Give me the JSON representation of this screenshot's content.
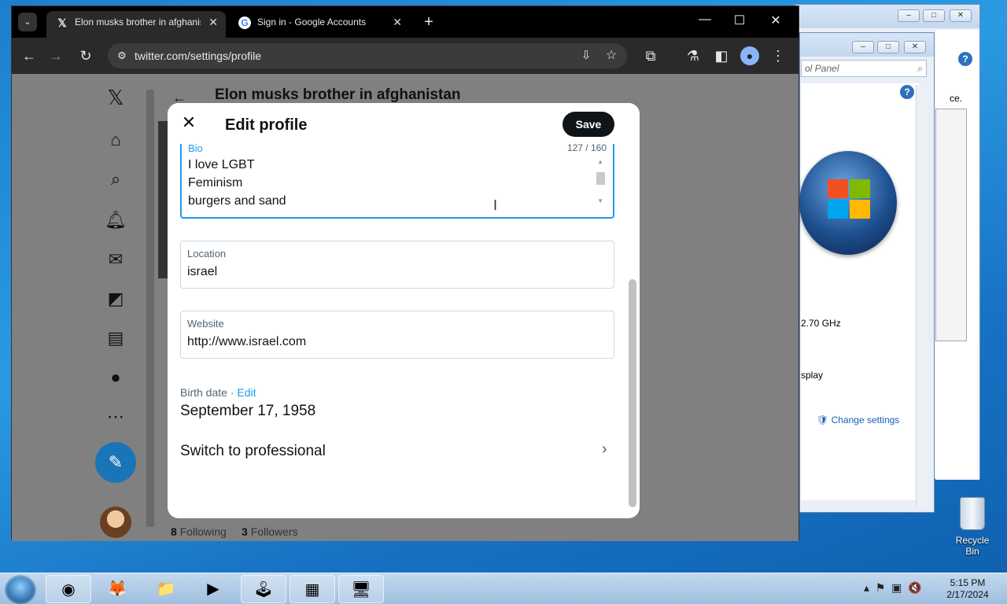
{
  "browser": {
    "tabs": [
      {
        "title": "Elon musks brother in afghanistan",
        "icon": "x-logo-icon",
        "active": true
      },
      {
        "title": "Sign in - Google Accounts",
        "icon": "google-icon",
        "active": false
      }
    ],
    "url": "twitter.com/settings/profile"
  },
  "profile_page": {
    "header_title": "Elon musks brother in afghanistan",
    "following_count": "8",
    "following_label": "Following",
    "followers_count": "3",
    "followers_label": "Followers"
  },
  "modal": {
    "title": "Edit profile",
    "save_label": "Save",
    "bio": {
      "label": "Bio",
      "counter": "127 / 160",
      "lines": [
        "I love LGBT",
        "Feminism",
        "burgers and sand"
      ]
    },
    "location": {
      "label": "Location",
      "value": "israel"
    },
    "website": {
      "label": "Website",
      "value": "http://www.israel.com"
    },
    "birth": {
      "label": "Birth date",
      "separator": " · ",
      "edit": "Edit",
      "value": "September 17, 1958"
    },
    "professional": "Switch to professional"
  },
  "control_panel": {
    "search_placeholder": "ol Panel",
    "text_ce": "ce.",
    "cpu_speed": "2.70 GHz",
    "display_fragment": "splay",
    "change_settings": "Change settings"
  },
  "desktop": {
    "recycle_bin": "Recycle Bin"
  },
  "taskbar": {
    "time": "5:15 PM",
    "date": "2/17/2024"
  },
  "colors": {
    "accent": "#1d9bf0",
    "save_button": "#0f1419",
    "compose_button": "#1a75b8"
  }
}
